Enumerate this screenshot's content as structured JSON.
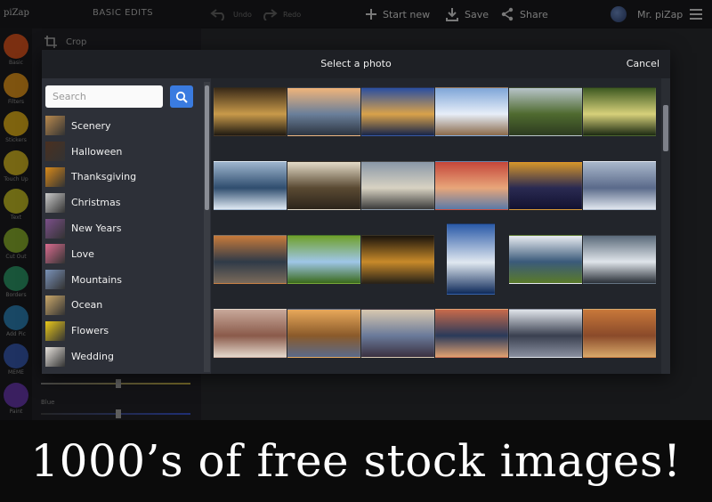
{
  "app": {
    "logo": "piZap",
    "panel_title": "BASIC EDITS",
    "toolbar": {
      "undo_label": "Undo",
      "redo_label": "Redo",
      "start_new_label": "Start new",
      "save_label": "Save",
      "share_label": "Share",
      "user_name": "Mr. piZap"
    },
    "tools": [
      {
        "label": "Basic",
        "icon": "sliders-icon",
        "color": "#e0561f"
      },
      {
        "label": "Filters",
        "icon": "palette-icon",
        "color": "#e89a1e"
      },
      {
        "label": "Stickers",
        "icon": "sticker-icon",
        "color": "#e6b51c"
      },
      {
        "label": "Touch Up",
        "icon": "smile-icon",
        "color": "#d9bc25"
      },
      {
        "label": "Text",
        "icon": "text-icon",
        "color": "#c9c227"
      },
      {
        "label": "Cut Out",
        "icon": "scissors-icon",
        "color": "#8db22f"
      },
      {
        "label": "Borders",
        "icon": "border-icon",
        "color": "#2f9c6b"
      },
      {
        "label": "Add Pic",
        "icon": "add-picture-icon",
        "color": "#2e83b8"
      },
      {
        "label": "MEME",
        "icon": "meme-icon",
        "color": "#3a5bb3"
      },
      {
        "label": "Paint",
        "icon": "brush-icon",
        "color": "#6a3ab0"
      }
    ],
    "crop_label": "Crop",
    "blue_label": "Blue"
  },
  "modal": {
    "title": "Select a photo",
    "cancel_label": "Cancel",
    "search_placeholder": "Search",
    "categories": [
      {
        "name": "Scenery",
        "thumb": "#b98a4e"
      },
      {
        "name": "Halloween",
        "thumb": "#4a3020"
      },
      {
        "name": "Thanksgiving",
        "thumb": "#d88a1a"
      },
      {
        "name": "Christmas",
        "thumb": "#c9c9c9"
      },
      {
        "name": "New Years",
        "thumb": "#7b4f8a"
      },
      {
        "name": "Love",
        "thumb": "#d96b8f"
      },
      {
        "name": "Mountains",
        "thumb": "#7a92b8"
      },
      {
        "name": "Ocean",
        "thumb": "#caa86a"
      },
      {
        "name": "Flowers",
        "thumb": "#e9c81a"
      },
      {
        "name": "Wedding",
        "thumb": "#e6e2dc"
      }
    ],
    "photos": [
      {
        "subject": "forest-sunset",
        "colors": [
          "#3a2a18",
          "#c89a4a",
          "#1f1a12"
        ]
      },
      {
        "subject": "pier-sunset",
        "colors": [
          "#f0b47a",
          "#6a7f9a",
          "#2c3440"
        ]
      },
      {
        "subject": "parliament-night",
        "colors": [
          "#2a4fa0",
          "#d9a24a",
          "#17254a"
        ]
      },
      {
        "subject": "blossom-branch",
        "colors": [
          "#7fa6d8",
          "#e7eef8",
          "#8a6a4a"
        ]
      },
      {
        "subject": "shipwreck-field",
        "colors": [
          "#b7c4c9",
          "#4f6a2f",
          "#2d3b20"
        ]
      },
      {
        "subject": "stream-rocks",
        "colors": [
          "#3e5a22",
          "#d6d07a",
          "#1c2a12"
        ]
      },
      {
        "subject": "pine-needles",
        "colors": [
          "#9fb6cf",
          "#2f4d6e",
          "#dfe9f3"
        ]
      },
      {
        "subject": "misty-forest",
        "colors": [
          "#e4dbc8",
          "#5a4a33",
          "#2b241a"
        ]
      },
      {
        "subject": "railway-tracks",
        "colors": [
          "#8a98a8",
          "#d8d2c2",
          "#3a3a3a"
        ]
      },
      {
        "subject": "red-sky-sea",
        "colors": [
          "#c4463a",
          "#e8a67a",
          "#5a7aa8"
        ]
      },
      {
        "subject": "city-skyline",
        "colors": [
          "#d8962a",
          "#2a2a52",
          "#121230"
        ]
      },
      {
        "subject": "lake-reflection",
        "colors": [
          "#aab8cc",
          "#5a6a8a",
          "#e0e6ee"
        ]
      },
      {
        "subject": "lake-dusk",
        "colors": [
          "#c87a3a",
          "#2f3a48",
          "#7a6a5a"
        ]
      },
      {
        "subject": "green-hill-tree",
        "colors": [
          "#6fa02a",
          "#9fc6e8",
          "#3a6a1a"
        ]
      },
      {
        "subject": "dark-woods-lights",
        "colors": [
          "#1a140c",
          "#c88a2a",
          "#2a2418"
        ]
      },
      {
        "subject": "lighthouse",
        "colors": [
          "#2a5aa8",
          "#e0e8f0",
          "#0e2a5a"
        ]
      },
      {
        "subject": "snowy-mountains",
        "colors": [
          "#e8ecf0",
          "#3a5a7a",
          "#5a7a2a"
        ]
      },
      {
        "subject": "waterfall-rocks",
        "colors": [
          "#5a6a7a",
          "#dfe4ea",
          "#2a3038"
        ]
      },
      {
        "subject": "foggy-autumn",
        "colors": [
          "#c8a89a",
          "#8a5a4a",
          "#e4d8cc"
        ]
      },
      {
        "subject": "boardwalk-sunset",
        "colors": [
          "#e8a85a",
          "#8a5a2a",
          "#5a6a8a"
        ]
      },
      {
        "subject": "sand-dunes",
        "colors": [
          "#d8c8b0",
          "#6a7a9a",
          "#3a3040"
        ]
      },
      {
        "subject": "mountain-lake",
        "colors": [
          "#c86a4a",
          "#2a3a5a",
          "#e0a070"
        ]
      },
      {
        "subject": "snowy-river",
        "colors": [
          "#e0e4ea",
          "#3a4050",
          "#8a90a0"
        ]
      },
      {
        "subject": "painted-hills",
        "colors": [
          "#c8783a",
          "#8a4a2a",
          "#d8a86a"
        ]
      }
    ]
  },
  "caption": {
    "text": "1000’s of free stock images!"
  }
}
